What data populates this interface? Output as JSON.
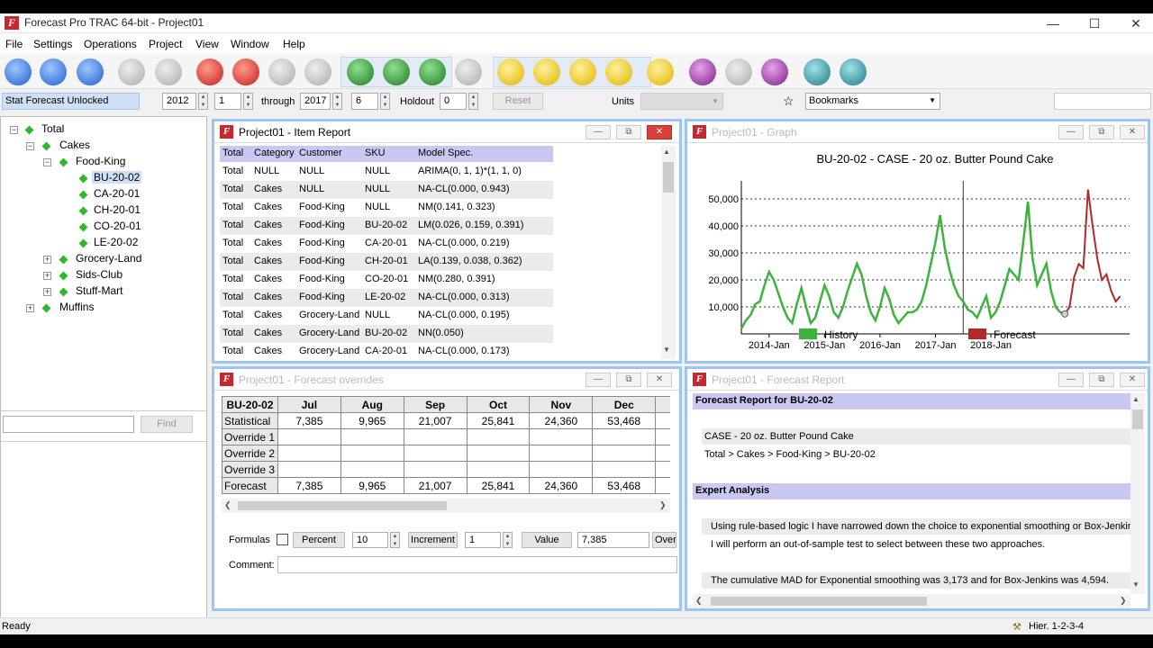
{
  "window": {
    "title": "Forecast Pro TRAC 64-bit - Project01"
  },
  "menu": [
    "File",
    "Settings",
    "Operations",
    "Project",
    "View",
    "Window",
    "Help"
  ],
  "toolbar_icons": [
    "new-icon",
    "open-icon",
    "save-icon",
    "copy-icon",
    "paste-icon",
    "database-icon",
    "pie-icon",
    "axis-icon",
    "refresh-icon",
    "report-icon",
    "forecast-icon",
    "forecast-all-icon",
    "paw-icon",
    "notes-icon",
    "filter-icon",
    "chart-edit-icon",
    "chart-line-icon",
    "hash-icon",
    "copy-window-icon",
    "print-icon",
    "export-icon",
    "settings-icon",
    "tools-icon"
  ],
  "options": {
    "status": "Stat Forecast Unlocked",
    "start_year": "2012",
    "start_period": "1",
    "through_label": "through",
    "end_year": "2017",
    "end_period": "6",
    "holdout_label": "Holdout",
    "holdout": "0",
    "reset": "Reset",
    "units_label": "Units",
    "bookmarks": "Bookmarks"
  },
  "tree": {
    "total": "Total",
    "cakes": "Cakes",
    "food_king": "Food-King",
    "skus": [
      "BU-20-02",
      "CA-20-01",
      "CH-20-01",
      "CO-20-01",
      "LE-20-02"
    ],
    "grocery_land": "Grocery-Land",
    "sids_club": "Sids-Club",
    "stuff_mart": "Stuff-Mart",
    "muffins": "Muffins",
    "find": "Find"
  },
  "item_report": {
    "title": "Project01 - Item Report",
    "headers": [
      "Total",
      "Category",
      "Customer",
      "SKU",
      "Model Spec."
    ],
    "rows": [
      [
        "Total",
        "NULL",
        "NULL",
        "NULL",
        "ARIMA(0, 1, 1)*(1, 1, 0)"
      ],
      [
        "Total",
        "Cakes",
        "NULL",
        "NULL",
        "NA-CL(0.000, 0.943)"
      ],
      [
        "Total",
        "Cakes",
        "Food-King",
        "NULL",
        "NM(0.141, 0.323)"
      ],
      [
        "Total",
        "Cakes",
        "Food-King",
        "BU-20-02",
        "LM(0.026, 0.159, 0.391)"
      ],
      [
        "Total",
        "Cakes",
        "Food-King",
        "CA-20-01",
        "NA-CL(0.000, 0.219)"
      ],
      [
        "Total",
        "Cakes",
        "Food-King",
        "CH-20-01",
        "LA(0.139, 0.038, 0.362)"
      ],
      [
        "Total",
        "Cakes",
        "Food-King",
        "CO-20-01",
        "NM(0.280, 0.391)"
      ],
      [
        "Total",
        "Cakes",
        "Food-King",
        "LE-20-02",
        "NA-CL(0.000, 0.313)"
      ],
      [
        "Total",
        "Cakes",
        "Grocery-Land",
        "NULL",
        "NA-CL(0.000, 0.195)"
      ],
      [
        "Total",
        "Cakes",
        "Grocery-Land",
        "BU-20-02",
        "NN(0.050)"
      ],
      [
        "Total",
        "Cakes",
        "Grocery-Land",
        "CA-20-01",
        "NA-CL(0.000, 0.173)"
      ]
    ]
  },
  "graph": {
    "title": "Project01 - Graph",
    "chart_title": "BU-20-02 - CASE - 20 oz. Butter Pound Cake",
    "legend_history": "History",
    "legend_forecast": "Forecast",
    "ytick_labels": [
      "10,000",
      "20,000",
      "30,000",
      "40,000",
      "50,000"
    ],
    "xtick_labels": [
      "2014-Jan",
      "2015-Jan",
      "2016-Jan",
      "2017-Jan",
      "2018-Jan"
    ]
  },
  "chart_data": {
    "type": "line",
    "title": "BU-20-02 - CASE - 20 oz. Butter Pound Cake",
    "xlabel": "",
    "ylabel": "",
    "ylim": [
      0,
      55000
    ],
    "x_start": "2013-Jul",
    "grid": true,
    "legend_position": "bottom",
    "colors": {
      "History": "#3cb33c",
      "Forecast": "#b02a2a"
    },
    "series": [
      {
        "name": "History",
        "start": "2013-Jul",
        "values": [
          2000,
          5000,
          7000,
          11000,
          12000,
          18000,
          23000,
          20000,
          15000,
          10000,
          6000,
          4000,
          11000,
          17000,
          10000,
          4000,
          6000,
          12000,
          18000,
          14000,
          8000,
          6000,
          10000,
          16000,
          21000,
          26000,
          22000,
          14000,
          8000,
          5000,
          10000,
          17000,
          13000,
          7000,
          4000,
          6000,
          8000,
          8000,
          9000,
          12000,
          18000,
          26000,
          34000,
          44000,
          32000,
          24000,
          18000,
          14000,
          12000,
          9000,
          8000,
          6000,
          10000,
          14000,
          6000,
          8000,
          12000,
          18000,
          24000,
          22000,
          20000,
          34000,
          49000,
          28000,
          18000,
          22000,
          26000,
          16000,
          10000,
          8000
        ]
      },
      {
        "name": "Forecast",
        "start": "2017-Jul",
        "values": [
          7385,
          9965,
          21007,
          25841,
          24360,
          53468,
          40000,
          28000,
          20000,
          22000,
          16000,
          12000,
          14000
        ]
      }
    ]
  },
  "overrides": {
    "title": "Project01 - Forecast overrides",
    "sku": "BU-20-02",
    "months": [
      "Jul",
      "Aug",
      "Sep",
      "Oct",
      "Nov",
      "Dec"
    ],
    "rows": [
      {
        "label": "Statistical",
        "values": [
          "7,385",
          "9,965",
          "21,007",
          "25,841",
          "24,360",
          "53,468"
        ]
      },
      {
        "label": "Override 1",
        "values": [
          "",
          "",
          "",
          "",
          "",
          ""
        ]
      },
      {
        "label": "Override 2",
        "values": [
          "",
          "",
          "",
          "",
          "",
          ""
        ]
      },
      {
        "label": "Override 3",
        "values": [
          "",
          "",
          "",
          "",
          "",
          ""
        ]
      },
      {
        "label": "Forecast",
        "values": [
          "7,385",
          "9,965",
          "21,007",
          "25,841",
          "24,360",
          "53,468"
        ]
      }
    ],
    "formulas_label": "Formulas",
    "percent_btn": "Percent",
    "percent_val": "10",
    "increment_btn": "Increment",
    "increment_val": "1",
    "value_btn": "Value",
    "value_val": "7,385",
    "over_btn": "Over",
    "comment_label": "Comment:"
  },
  "forecast_report": {
    "title": "Project01 - Forecast Report",
    "heading": "Forecast Report for BU-20-02",
    "product": "CASE - 20 oz. Butter Pound Cake",
    "path": "Total > Cakes > Food-King > BU-20-02",
    "expert_heading": "Expert Analysis",
    "para1": "Using rule-based logic I have narrowed down the choice to exponential smoothing or Box-Jenkins",
    "para2": "I will perform an out-of-sample test to select between these two approaches.",
    "para3": "The cumulative MAD for Exponential smoothing was 3,173 and for Box-Jenkins was 4,594."
  },
  "status": {
    "ready": "Ready",
    "hier": "Hier. 1-2-3-4"
  }
}
